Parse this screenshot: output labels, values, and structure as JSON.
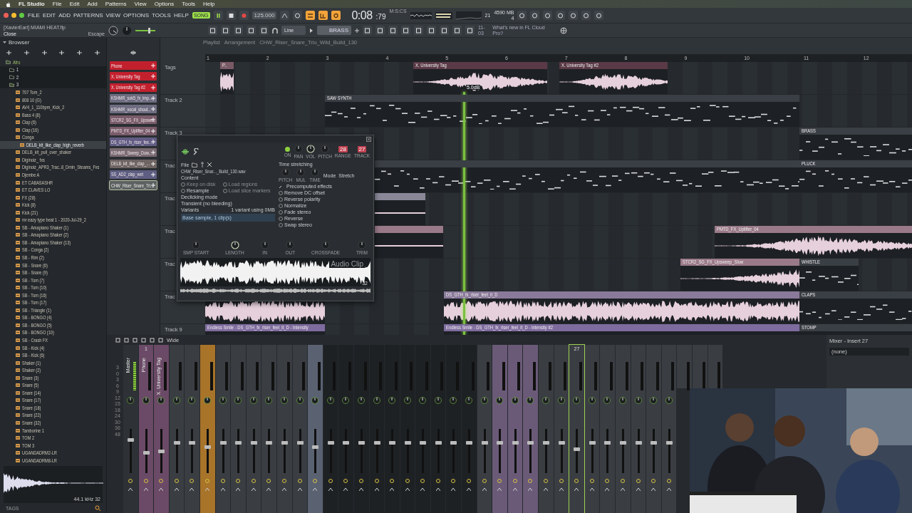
{
  "mac_menu": {
    "app": "FL Studio",
    "items": [
      "File",
      "Edit",
      "Add",
      "Patterns",
      "View",
      "Options",
      "Tools",
      "Help"
    ]
  },
  "toolbar": {
    "menu": [
      "FILE",
      "EDIT",
      "ADD",
      "PATTERNS",
      "VIEW",
      "OPTIONS",
      "TOOLS",
      "HELP"
    ],
    "mode": "SONG",
    "song_mode": true,
    "tempo": "125.000",
    "time": "0:08",
    "time_fraction": ":79",
    "time_unit": "M:S:CS",
    "cpu": "21",
    "memory": "4590 MB",
    "polyphony": "4",
    "hint_title": "[XavierEarl] MIAMI HEAT.flp",
    "hint_text": "Close",
    "hint_key": "Escape",
    "snap": "Line",
    "pattern": "BRASS",
    "news_date": "11-03",
    "news_text": "What's new in FL Cloud Pro?"
  },
  "browser": {
    "title": "Browser",
    "tree": [
      {
        "label": "Afro",
        "kind": "folder",
        "expanded": true,
        "selected": false,
        "children": [
          {
            "label": "1",
            "kind": "folder",
            "expanded": false,
            "selected": false
          },
          {
            "label": "2",
            "kind": "folder",
            "expanded": false,
            "selected": false
          },
          {
            "label": "3",
            "kind": "folder",
            "expanded": true,
            "selected": false,
            "children": [
              {
                "label": "707 Tom_2",
                "kind": "pack",
                "selected": false
              },
              {
                "label": "808 10 (G)",
                "kind": "pack",
                "selected": false
              },
              {
                "label": "AV4_1_110bpm_Kick_2",
                "kind": "pack",
                "selected": false
              },
              {
                "label": "Bass 4 (8)",
                "kind": "pack",
                "selected": false
              },
              {
                "label": "Clap  (6)",
                "kind": "pack",
                "selected": false
              },
              {
                "label": "Clap  (16)",
                "kind": "pack",
                "selected": false
              },
              {
                "label": "Conga",
                "kind": "pack",
                "expanded": true,
                "selected": false,
                "children": [
                  {
                    "label": "DELB_kit_like_clap_high_reverb",
                    "kind": "pack",
                    "selected": true
                  }
                ]
              },
              {
                "label": "DELB_kit_pull_over_shaker",
                "kind": "pack",
                "selected": false
              },
              {
                "label": "Diginoiz_ fxs",
                "kind": "pack",
                "selected": false
              },
              {
                "label": "Diginoiz_APR3_Trac..8_Dmin_Steams_Fxs",
                "kind": "pack",
                "selected": false
              },
              {
                "label": "Djembe A",
                "kind": "pack",
                "selected": false
              },
              {
                "label": "ET CABASASHR",
                "kind": "pack",
                "selected": false
              },
              {
                "label": "ET CLAVES LO",
                "kind": "pack",
                "selected": false
              },
              {
                "label": "FX  (28)",
                "kind": "pack",
                "selected": false
              },
              {
                "label": "Kick  (8)",
                "kind": "pack",
                "selected": false
              },
              {
                "label": "Kick  (21)",
                "kind": "pack",
                "selected": false
              },
              {
                "label": "mr eazy type beat 1 - 2020-Jul-29_2",
                "kind": "pack",
                "selected": false
              },
              {
                "label": "SB  - Amapiano Shaker (1)",
                "kind": "pack",
                "selected": false
              },
              {
                "label": "SB  - Amapiano Shaker (2)",
                "kind": "pack",
                "selected": false
              },
              {
                "label": "SB  - Amapiano Shaker (13)",
                "kind": "pack",
                "selected": false
              },
              {
                "label": "SB  - Conga  (2)",
                "kind": "pack",
                "selected": false
              },
              {
                "label": "SB  - Rim (2)",
                "kind": "pack",
                "selected": false
              },
              {
                "label": "SB  - Snare (6)",
                "kind": "pack",
                "selected": false
              },
              {
                "label": "SB  - Snare (9)",
                "kind": "pack",
                "selected": false
              },
              {
                "label": "SB  - Tom (7)",
                "kind": "pack",
                "selected": false
              },
              {
                "label": "SB  - Tom (10)",
                "kind": "pack",
                "selected": false
              },
              {
                "label": "SB  - Tom (16)",
                "kind": "pack",
                "selected": false
              },
              {
                "label": "SB  - Tom (17)",
                "kind": "pack",
                "selected": false
              },
              {
                "label": "SB  - Triangle (1)",
                "kind": "pack",
                "selected": false
              },
              {
                "label": "SB - BONGO (4)",
                "kind": "pack",
                "selected": false
              },
              {
                "label": "SB - BONGO (5)",
                "kind": "pack",
                "selected": false
              },
              {
                "label": "SB - BONGO (10)",
                "kind": "pack",
                "selected": false
              },
              {
                "label": "SB - Crash FX",
                "kind": "pack",
                "selected": false
              },
              {
                "label": "SB - Kick (4)",
                "kind": "pack",
                "selected": false
              },
              {
                "label": "SB - Kick (6)",
                "kind": "pack",
                "selected": false
              },
              {
                "label": "Shaker  (1)",
                "kind": "pack",
                "selected": false
              },
              {
                "label": "Shaker  (2)",
                "kind": "pack",
                "selected": false
              },
              {
                "label": "Snare  (3)",
                "kind": "pack",
                "selected": false
              },
              {
                "label": "Snare  (5)",
                "kind": "pack",
                "selected": false
              },
              {
                "label": "Snare  (14)",
                "kind": "pack",
                "selected": false
              },
              {
                "label": "Snare  (17)",
                "kind": "pack",
                "selected": false
              },
              {
                "label": "Snare  (18)",
                "kind": "pack",
                "selected": false
              },
              {
                "label": "Snare  (22)",
                "kind": "pack",
                "selected": false
              },
              {
                "label": "Snare  (32)",
                "kind": "pack",
                "selected": false
              },
              {
                "label": "Tamborine 1",
                "kind": "pack",
                "selected": false
              },
              {
                "label": "TOM 2",
                "kind": "pack",
                "selected": false
              },
              {
                "label": "TOM 3",
                "kind": "pack",
                "selected": false
              },
              {
                "label": "UGANDADRM2-LR",
                "kind": "pack",
                "selected": false
              },
              {
                "label": "UGANDADRM8-LR",
                "kind": "pack",
                "selected": false
              }
            ]
          }
        ]
      }
    ],
    "sample_rate": "44.1 kHz",
    "bit_depth": "32",
    "tags": "TAGS"
  },
  "clips": [
    {
      "label": "Phone",
      "color": "#c3202e",
      "selected": false
    },
    {
      "label": "X. University Tag",
      "color": "#c3202e",
      "selected": false
    },
    {
      "label": "X. University Tag #2",
      "color": "#c3202e",
      "selected": false
    },
    {
      "label": "KSHMR_sok5_fx_imp...",
      "color": "#6e6c80",
      "selected": false
    },
    {
      "label": "KSHMR_vocal_shout...",
      "color": "#6e6c80",
      "selected": false
    },
    {
      "label": "STCR2_SG_FX_Upswe...",
      "color": "#7a5c6a",
      "selected": false
    },
    {
      "label": "PMTD_FX_Uplifter_04",
      "color": "#7a5c6a",
      "selected": false
    },
    {
      "label": "DS_GTH_fx_riser_fee...",
      "color": "#625c84",
      "selected": false
    },
    {
      "label": "KSHMR_Sweep_Dow...",
      "color": "#7a6a72",
      "selected": false
    },
    {
      "label": "DELB_kit_like_clap_...",
      "color": "#6e6462",
      "selected": false
    },
    {
      "label": "SS_AD2_clap_wet",
      "color": "#5e5e82",
      "selected": false
    },
    {
      "label": "CHW_Riser_Snare_Tri...",
      "color": "#5c6262",
      "selected": true
    }
  ],
  "playlist": {
    "title": "Playlist",
    "path": [
      "Arrangement",
      "CHW_Riser_Snare_Trio_Wild_Build_130"
    ],
    "bars": [
      "1",
      "2",
      "3",
      "4",
      "5",
      "6",
      "7",
      "8",
      "9",
      "10",
      "11",
      "12"
    ],
    "volume_hint": "5.0dB",
    "tracks": [
      {
        "name": "Tags",
        "clips": [
          {
            "label": "P..",
            "kind": "audio",
            "color": "#7a5a66"
          },
          {
            "label": "X. University Tag",
            "kind": "audio",
            "color": "#5a3a46"
          },
          {
            "label": "X. University Tag #2",
            "kind": "audio",
            "color": "#5a3a46"
          }
        ]
      },
      {
        "name": "Track 2",
        "clips": [
          {
            "label": "SAW SYNTH",
            "kind": "pattern",
            "color": "#3a3f45"
          }
        ]
      },
      {
        "name": "Track 3",
        "clips": [
          {
            "label": "BRASS",
            "kind": "pattern",
            "color": "#3a3f45"
          }
        ]
      },
      {
        "name": "Trac",
        "clips": [
          {
            "kind": "pattern"
          },
          {
            "label": "PLUCK",
            "kind": "pattern",
            "color": "#3a3f45"
          }
        ]
      },
      {
        "name": "Trac",
        "clips": [
          {
            "kind": "audio",
            "color": "#8a8898"
          }
        ]
      },
      {
        "name": "Trac",
        "clips": [
          {
            "kind": "audio",
            "color": "#9a7a88"
          },
          {
            "label": "PMTD_FX_Uplifter_04",
            "kind": "audio",
            "color": "#9a7a88"
          }
        ]
      },
      {
        "name": "Trac",
        "clips": [
          {
            "label": "STCR2_SG_FX_Upsweep_Slow",
            "kind": "audio",
            "color": "#9a7a88"
          },
          {
            "label": "WHISTLE",
            "kind": "pattern",
            "color": "#3a3f45"
          }
        ]
      },
      {
        "name": "Trac",
        "clips": [
          {
            "kind": "audio"
          },
          {
            "label": "DS_GTH_fx_riser_feel_it_D",
            "kind": "audio",
            "color": "#8a7a9a"
          },
          {
            "label": "CLAPS",
            "kind": "pattern",
            "color": "#3a3f45"
          }
        ]
      },
      {
        "name": "Track 9",
        "clips": [
          {
            "label": "Endless Smile - DS_GTH_fx_riser_feel_it_D - Intensity",
            "kind": "automation",
            "color": "#7e6c9e"
          },
          {
            "label": "Endless Smile - DS_GTH_fx_riser_feel_it_D - Intensity #2",
            "kind": "automation",
            "color": "#7e6c9e"
          },
          {
            "label": "STOMP",
            "kind": "pattern",
            "color": "#3a3f45"
          }
        ]
      }
    ]
  },
  "audio_clip": {
    "controls": [
      {
        "kind": "led",
        "label": "ON",
        "on": true
      },
      {
        "kind": "knob",
        "label": "PAN",
        "on": false
      },
      {
        "kind": "knob",
        "label": "VOL",
        "on": true
      },
      {
        "kind": "knob",
        "label": "PITCH",
        "on": false
      },
      {
        "kind": "display",
        "label": "RANGE",
        "value": "28"
      },
      {
        "kind": "display",
        "label": "TRACK",
        "value": "27"
      }
    ],
    "file_label": "File",
    "file_name": "CHW_Riser_Snar..._Build_130.wav",
    "content_title": "Content",
    "content_options": [
      {
        "label": "Keep on disk",
        "checked": false,
        "disabled": true
      },
      {
        "label": "Load regions",
        "checked": false,
        "disabled": true
      },
      {
        "label": "Resample",
        "checked": false,
        "disabled": false
      },
      {
        "label": "Load slice markers",
        "checked": false,
        "disabled": true
      }
    ],
    "declick_label": "Declicking mode",
    "declick_value": "Transient (no bleeding)",
    "variants_title": "Variants",
    "variants_info": "1 variant using 0MB",
    "variant": "Base sample, 1 clip(s)",
    "stretch_title": "Time stretching",
    "mode_label": "Mode",
    "mode_value": "Stretch",
    "stretch_knobs": [
      {
        "label": "PITCH",
        "on": false
      },
      {
        "label": "MUL",
        "on": false
      },
      {
        "label": "TIME",
        "on": false
      }
    ],
    "effects_title": "Precomputed effects",
    "effects": [
      {
        "label": "Remove DC offset",
        "checked": false
      },
      {
        "label": "Reverse polarity",
        "checked": false
      },
      {
        "label": "Normalize",
        "checked": false
      },
      {
        "label": "Fade stereo",
        "checked": false
      },
      {
        "label": "Reverse",
        "checked": false
      },
      {
        "label": "Swap stereo",
        "checked": false
      }
    ],
    "sample_knobs": [
      {
        "label": "SMP START",
        "on": false
      },
      {
        "label": "LENGTH",
        "on": true
      },
      {
        "label": "IN",
        "on": false
      },
      {
        "label": "OUT",
        "on": false
      },
      {
        "label": "CROSSFADE",
        "on": false
      },
      {
        "label": "TRIM",
        "on": false
      }
    ],
    "watermark": "Audio Clip",
    "bits": "32"
  },
  "mixer": {
    "mode": "Wide",
    "title": "Mixer - Insert 27",
    "route": "(none)",
    "scale": [
      "3",
      "0",
      "3",
      "6",
      "9",
      "12",
      "15",
      "18",
      "24",
      "30",
      "36",
      "48"
    ],
    "master": {
      "label": "Master",
      "level": 0.78
    },
    "strips": [
      {
        "number": "1",
        "label": "Phone",
        "color": "#6a4a66",
        "selected": false,
        "level": 0.45
      },
      {
        "label": "X. University Tag",
        "color": "#6a4a66",
        "selected": false,
        "level": 0.5
      },
      {
        "color": "#3a3e43",
        "selected": false,
        "level": 0.7
      },
      {
        "color": "#3a3e43",
        "selected": false,
        "level": 0.7
      },
      {
        "color": "#a8742a",
        "selected": false,
        "level": 0.6
      },
      {
        "color": "#3a3e43",
        "selected": false,
        "level": 0.7
      },
      {
        "color": "#3a3e43",
        "selected": false,
        "level": 0.7
      },
      {
        "color": "#3a3e43",
        "selected": false,
        "level": 0.7
      },
      {
        "color": "#3a3e43",
        "selected": false,
        "level": 0.7
      },
      {
        "color": "#3a3e43",
        "selected": false,
        "level": 0.7
      },
      {
        "color": "#3a3e43",
        "selected": false,
        "level": 0.7
      },
      {
        "color": "#5a6272",
        "selected": false,
        "level": 0.6
      },
      {
        "color": "#1e2124",
        "selected": false,
        "level": 0.7
      },
      {
        "color": "#1e2124",
        "selected": false,
        "level": 0.7
      },
      {
        "color": "#1e2124",
        "selected": false,
        "level": 0.7
      },
      {
        "color": "#1e2124",
        "selected": false,
        "level": 0.7
      },
      {
        "color": "#1e2124",
        "selected": false,
        "level": 0.7
      },
      {
        "color": "#1e2124",
        "selected": false,
        "level": 0.7
      },
      {
        "color": "#1e2124",
        "selected": false,
        "level": 0.7
      },
      {
        "color": "#1e2124",
        "selected": false,
        "level": 0.7
      },
      {
        "color": "#1e2124",
        "selected": false,
        "level": 0.7
      },
      {
        "color": "#1e2124",
        "selected": false,
        "level": 0.7
      },
      {
        "color": "#3a3e43",
        "selected": false,
        "level": 0.7
      },
      {
        "color": "#6a5a78",
        "selected": false,
        "level": 0.7
      },
      {
        "color": "#6a5a78",
        "selected": false,
        "level": 0.7
      },
      {
        "color": "#6a5a78",
        "selected": false,
        "level": 0.7
      },
      {
        "color": "#3a3e43",
        "selected": false,
        "level": 0.7
      },
      {
        "color": "#3a3e43",
        "selected": false,
        "level": 0.7
      },
      {
        "number": "27",
        "color": "#3a3e43",
        "selected": true,
        "level": 0.55
      },
      {
        "color": "#3a3e43",
        "selected": false,
        "level": 0.7
      },
      {
        "color": "#3a3e43",
        "selected": false,
        "level": 0.7
      },
      {
        "color": "#3a3e43",
        "selected": false,
        "level": 0.7
      },
      {
        "color": "#3a3e43",
        "selected": false,
        "level": 0.7
      },
      {
        "color": "#3a3e43",
        "selected": false,
        "level": 0.7
      },
      {
        "color": "#3a3e43",
        "selected": false,
        "level": 0.7
      },
      {
        "color": "#3a3e43",
        "selected": false
      },
      {
        "color": "#3a3e43",
        "selected": false
      },
      {
        "color": "#3a3e43",
        "selected": false
      }
    ]
  }
}
